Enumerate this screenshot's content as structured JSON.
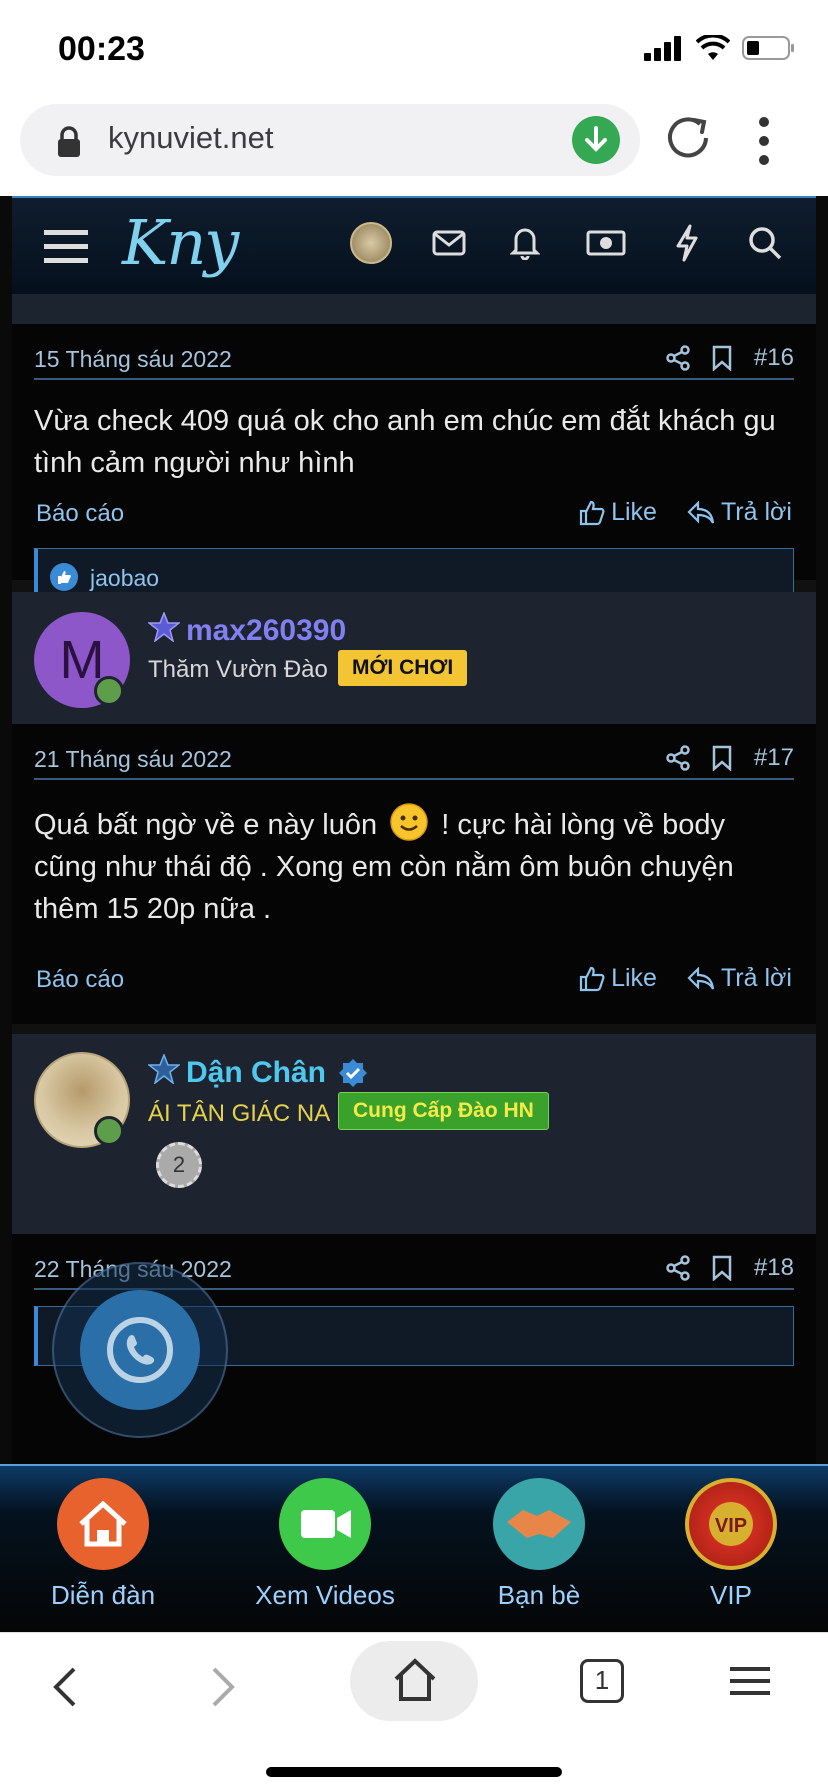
{
  "status": {
    "time": "00:23"
  },
  "browser": {
    "url": "kynuviet.net",
    "tab_count": "1"
  },
  "site": {
    "logo": "Kny"
  },
  "posts": [
    {
      "date": "15 Tháng sáu 2022",
      "number": "#16",
      "body": "Vừa check 409 quá ok cho anh em chúc em đắt khách gu tình cảm người như hình",
      "report": "Báo cáo",
      "like": "Like",
      "reply": "Trả lời",
      "reaction_user": "jaobao"
    },
    {
      "author": "max260390",
      "avatar_letter": "M",
      "user_title": "Thăm Vườn Đào",
      "badge": "MỚI CHƠI",
      "date": "21 Tháng sáu 2022",
      "number": "#17",
      "body_part1": "Quá bất ngờ về e này luôn",
      "body_part2": "! cực hài lòng về body cũng như thái độ . Xong em còn nằm ôm buôn chuyện thêm 15 20p nữa .",
      "report": "Báo cáo",
      "like": "Like",
      "reply": "Trả lời"
    },
    {
      "author": "Dận Chân",
      "user_title": "ÁI TÂN GIÁC NA",
      "badge": "Cung Cấp Đào HN",
      "date": "22 Tháng sáu 2022",
      "number": "#18"
    }
  ],
  "bottom_tabs": [
    {
      "label": "Diễn đàn",
      "color": "#e8622e"
    },
    {
      "label": "Xem Videos",
      "color": "#3fc94a"
    },
    {
      "label": "Bạn bè",
      "color": "#3aa5a8"
    },
    {
      "label": "VIP",
      "color": "#c8261a"
    }
  ]
}
